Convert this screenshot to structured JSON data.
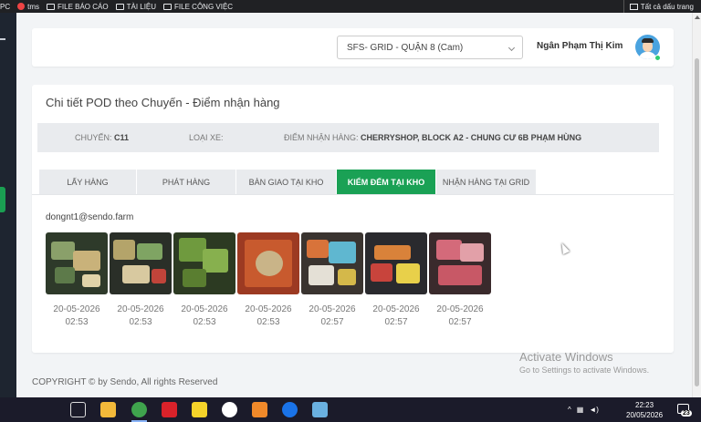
{
  "bookmarks": {
    "items": [
      {
        "label": "PC",
        "icon": "page-icon"
      },
      {
        "label": "tms",
        "icon": "tms-icon"
      },
      {
        "label": "FILE BÁO CÁO",
        "icon": "folder-icon"
      },
      {
        "label": "TÀI LIỆU",
        "icon": "folder-icon"
      },
      {
        "label": "FILE CÔNG VIỆC",
        "icon": "folder-icon"
      }
    ],
    "all_bookmarks": "Tất cả dấu trang"
  },
  "header": {
    "hub_select_value": "SFS- GRID - QUẬN 8 (Cam)",
    "user_name": "Ngân Phạm Thị Kim"
  },
  "card": {
    "title": "Chi tiết POD theo Chuyến - Điểm nhận hàng",
    "info": {
      "trip_label": "CHUYẾN:",
      "trip_value": "C11",
      "vehicle_label": "LOẠI XE:",
      "vehicle_value": "",
      "pickup_label": "ĐIỂM NHẬN HÀNG:",
      "pickup_value": "CHERRYSHOP, BLOCK A2 - CHUNG CƯ 6B PHẠM HÙNG"
    },
    "tabs": [
      {
        "label": "LẤY HÀNG",
        "active": false
      },
      {
        "label": "PHÁT HÀNG",
        "active": false
      },
      {
        "label": "BÀN GIAO TẠI KHO",
        "active": false
      },
      {
        "label": "KIỂM ĐẾM TẠI KHO",
        "active": true
      },
      {
        "label": "NHẬN HÀNG TẠI GRID",
        "active": false
      }
    ],
    "email": "dongnt1@sendo.farm",
    "photos": [
      {
        "date": "20-05-2026",
        "time": "02:53"
      },
      {
        "date": "20-05-2026",
        "time": "02:53"
      },
      {
        "date": "20-05-2026",
        "time": "02:53"
      },
      {
        "date": "20-05-2026",
        "time": "02:53"
      },
      {
        "date": "20-05-2026",
        "time": "02:57"
      },
      {
        "date": "20-05-2026",
        "time": "02:57"
      },
      {
        "date": "20-05-2026",
        "time": "02:57"
      }
    ]
  },
  "footer": {
    "copyright": "COPYRIGHT © by Sendo, All rights Reserved"
  },
  "watermark": {
    "line1": "Activate Windows",
    "line2": "Go to Settings to activate Windows."
  },
  "taskbar": {
    "time": "22:23",
    "date": "20/05/2026",
    "notification_count": "23"
  },
  "colors": {
    "accent": "#1aa155",
    "sidebar": "#1e2530",
    "background": "#f2f4f6"
  }
}
